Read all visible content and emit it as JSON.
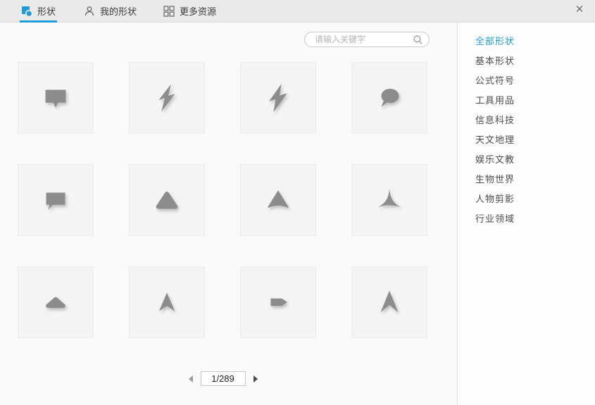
{
  "colors": {
    "accent": "#1e9dd8",
    "shape_fill": "#8c8c8c",
    "tile_bg": "#f4f4f4",
    "header_bg": "#eaeaea",
    "content_bg": "#fafafa"
  },
  "header": {
    "tabs": [
      {
        "label": "形状",
        "icon": "shapes-icon",
        "active": true
      },
      {
        "label": "我的形状",
        "icon": "my-shapes-icon",
        "active": false
      },
      {
        "label": "更多资源",
        "icon": "more-resources-icon",
        "active": false
      }
    ],
    "close_label": "×"
  },
  "search": {
    "placeholder": "请输入关键字",
    "value": "",
    "icon": "search-icon"
  },
  "sidebar": {
    "items": [
      {
        "label": "全部形状",
        "active": true
      },
      {
        "label": "基本形状",
        "active": false
      },
      {
        "label": "公式符号",
        "active": false
      },
      {
        "label": "工具用品",
        "active": false
      },
      {
        "label": "信息科技",
        "active": false
      },
      {
        "label": "天文地理",
        "active": false
      },
      {
        "label": "娱乐文教",
        "active": false
      },
      {
        "label": "生物世界",
        "active": false
      },
      {
        "label": "人物剪影",
        "active": false
      },
      {
        "label": "行业领域",
        "active": false
      }
    ]
  },
  "shape_tiles": [
    {
      "icon": "callout-rect-bottom-center"
    },
    {
      "icon": "lightning-bolt-1"
    },
    {
      "icon": "lightning-bolt-2"
    },
    {
      "icon": "callout-oval"
    },
    {
      "icon": "callout-rect-bottom-left"
    },
    {
      "icon": "triangle-rounded"
    },
    {
      "icon": "triangle-curved-base"
    },
    {
      "icon": "tricorn"
    },
    {
      "icon": "triangle-flat-rounded"
    },
    {
      "icon": "arrowhead-up"
    },
    {
      "icon": "arrow-pentagon-right"
    },
    {
      "icon": "arrowhead-up-deep"
    }
  ],
  "pagination": {
    "page_indicator": "1/289",
    "prev_icon": "left-arrow-icon",
    "next_icon": "right-arrow-icon"
  }
}
